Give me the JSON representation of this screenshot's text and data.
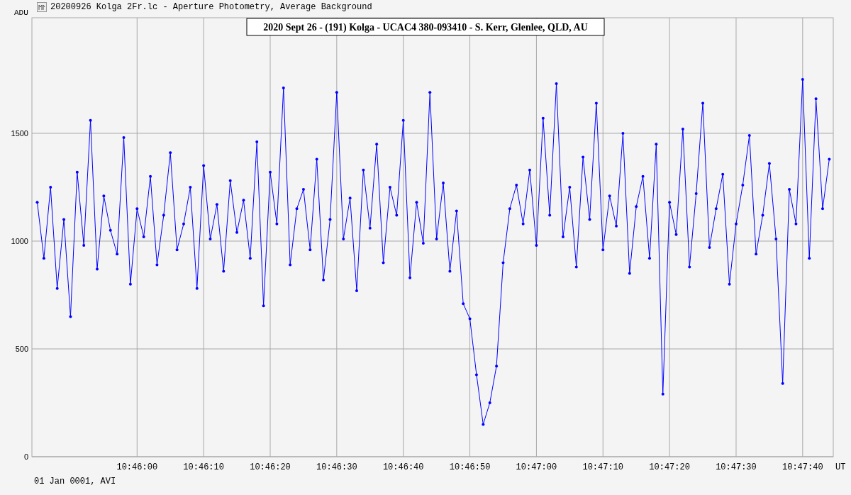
{
  "window": {
    "title": "20200926 Kolga 2Fr.lc - Aperture Photometry, Average Background"
  },
  "chart": {
    "chart_data": {
      "type": "line",
      "title": "2020 Sept 26 - (191) Kolga - UCAC4 380-093410 - S. Kerr, Glenlee, QLD, AU",
      "ylabel": "ADU",
      "xlabel": "UT",
      "grid": true,
      "xlim": [
        38744.2,
        38864.6
      ],
      "ylim": [
        0,
        2036
      ],
      "xticks": [
        {
          "value": 38760,
          "label": "10:46:00"
        },
        {
          "value": 38770,
          "label": "10:46:10"
        },
        {
          "value": 38780,
          "label": "10:46:20"
        },
        {
          "value": 38790,
          "label": "10:46:30"
        },
        {
          "value": 38800,
          "label": "10:46:40"
        },
        {
          "value": 38810,
          "label": "10:46:50"
        },
        {
          "value": 38820,
          "label": "10:47:00"
        },
        {
          "value": 38830,
          "label": "10:47:10"
        },
        {
          "value": 38840,
          "label": "10:47:20"
        },
        {
          "value": 38850,
          "label": "10:47:30"
        },
        {
          "value": 38860,
          "label": "10:47:40"
        }
      ],
      "yticks": [
        0,
        500,
        1000,
        1500
      ],
      "x": [
        38745,
        38746,
        38747,
        38748,
        38749,
        38750,
        38751,
        38752,
        38753,
        38754,
        38755,
        38756,
        38757,
        38758,
        38759,
        38760,
        38761,
        38762,
        38763,
        38764,
        38765,
        38766,
        38767,
        38768,
        38769,
        38770,
        38771,
        38772,
        38773,
        38774,
        38775,
        38776,
        38777,
        38778,
        38779,
        38780,
        38781,
        38782,
        38783,
        38784,
        38785,
        38786,
        38787,
        38788,
        38789,
        38790,
        38791,
        38792,
        38793,
        38794,
        38795,
        38796,
        38797,
        38798,
        38799,
        38800,
        38801,
        38802,
        38803,
        38804,
        38805,
        38806,
        38807,
        38808,
        38809,
        38810,
        38811,
        38812,
        38813,
        38814,
        38815,
        38816,
        38817,
        38818,
        38819,
        38820,
        38821,
        38822,
        38823,
        38824,
        38825,
        38826,
        38827,
        38828,
        38829,
        38830,
        38831,
        38832,
        38833,
        38834,
        38835,
        38836,
        38837,
        38838,
        38839,
        38840,
        38841,
        38842,
        38843,
        38844,
        38845,
        38846,
        38847,
        38848,
        38849,
        38850,
        38851,
        38852,
        38853,
        38854,
        38855,
        38856,
        38857,
        38858,
        38859,
        38860,
        38861,
        38862,
        38863,
        38864
      ],
      "series": [
        {
          "color": "#0000ff",
          "values": [
            1180,
            920,
            1250,
            780,
            1100,
            650,
            1320,
            980,
            1560,
            870,
            1210,
            1050,
            940,
            1480,
            800,
            1150,
            1020,
            1300,
            890,
            1120,
            1410,
            960,
            1080,
            1250,
            780,
            1350,
            1010,
            1170,
            860,
            1280,
            1040,
            1190,
            920,
            1460,
            700,
            1320,
            1080,
            1710,
            890,
            1150,
            1240,
            960,
            1380,
            820,
            1100,
            1690,
            1010,
            1200,
            770,
            1330,
            1060,
            1450,
            900,
            1250,
            1120,
            1560,
            830,
            1180,
            990,
            1690,
            1010,
            1270,
            860,
            1140,
            710,
            640,
            380,
            150,
            250,
            420,
            900,
            1150,
            1260,
            1080,
            1330,
            980,
            1570,
            1120,
            1730,
            1020,
            1250,
            880,
            1390,
            1100,
            1640,
            960,
            1210,
            1070,
            1500,
            850,
            1160,
            1300,
            920,
            1450,
            290,
            1180,
            1030,
            1520,
            880,
            1220,
            1640,
            970,
            1150,
            1310,
            800,
            1080,
            1260,
            1490,
            940,
            1120,
            1360,
            1010,
            340,
            1240,
            1080,
            1750,
            920,
            1660,
            1150,
            1380
          ]
        }
      ]
    }
  },
  "footer": "01 Jan 0001, AVI"
}
